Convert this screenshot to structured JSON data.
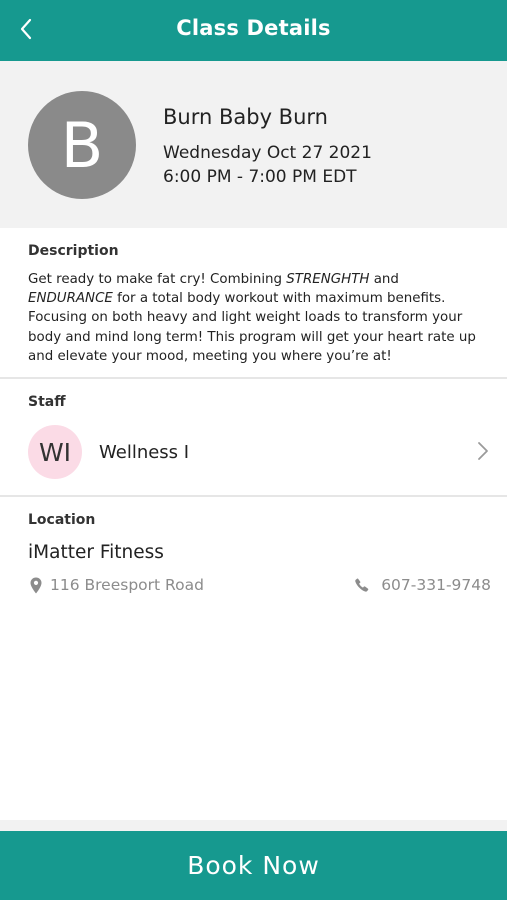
{
  "header": {
    "title": "Class Details",
    "back_icon": "chevron-left-icon",
    "color": "#16998f"
  },
  "class_info": {
    "avatar_letter": "B",
    "name": "Burn Baby Burn",
    "date": "Wednesday Oct 27 2021",
    "time": "6:00 PM - 7:00 PM EDT"
  },
  "description": {
    "label": "Description",
    "text_part1": " Get ready to make fat cry! Combining ",
    "emphasis1": "STRENGHTH",
    "text_part2": " and ",
    "emphasis2": "ENDURANCE",
    "text_part3": " for a total body workout with maximum benefits. Focusing on both heavy and light weight loads to transform your body and mind long term! This program will get your heart rate up and elevate your mood, meeting you where you’re at!"
  },
  "staff": {
    "label": "Staff",
    "initials": "WI",
    "name": "Wellness I",
    "chevron_icon": "chevron-right-icon"
  },
  "location": {
    "label": "Location",
    "name": "iMatter Fitness",
    "address": "116 Breesport Road",
    "address_icon": "map-pin-icon",
    "phone": "607-331-9748",
    "phone_icon": "phone-icon"
  },
  "footer": {
    "book_label": "Book Now"
  }
}
